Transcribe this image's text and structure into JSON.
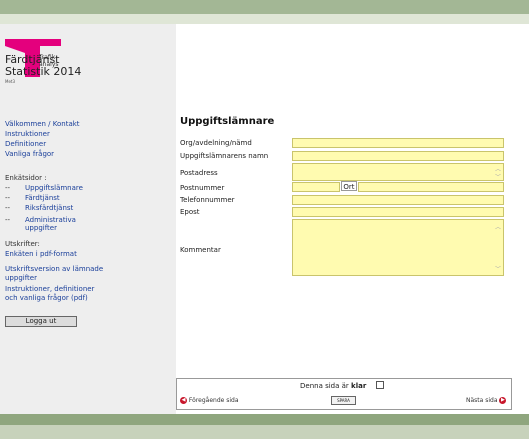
{
  "app": {
    "logo_text_line1": "Trafik",
    "logo_text_line2": "analys",
    "title_line1": "Färdtjänst",
    "title_line2": "Statistik 2014",
    "subtitle": "Met3"
  },
  "sidebar": {
    "links": [
      "Välkommen / Kontakt",
      "Instruktioner",
      "Definitioner",
      "Vanliga frågor"
    ],
    "enkat_heading": "Enkätsidor :",
    "enkat_items": [
      {
        "dash": "--",
        "label": "Uppgiftslämnare"
      },
      {
        "dash": "--",
        "label": "Färdtjänst"
      },
      {
        "dash": "--",
        "label": "Riksfärdtjänst"
      },
      {
        "dash": "--",
        "label_line1": "Administrativa",
        "label_line2": "uppgifter"
      }
    ],
    "utskrifter_heading": "Utskrifter:",
    "print_links": [
      {
        "line1": "Enkäten i pdf-format"
      },
      {
        "line1": "Utskriftsversion av lämnade",
        "line2": "uppgifter"
      },
      {
        "line1": "Instruktioner, definitioner",
        "line2": "och vanliga frågor (pdf)"
      }
    ],
    "logout_label": "Logga ut"
  },
  "form": {
    "heading": "Uppgiftslämnare",
    "fields": {
      "org": {
        "label": "Org/avdelning/nämd",
        "value": ""
      },
      "name": {
        "label": "Uppgiftslämnarens namn",
        "value": ""
      },
      "address": {
        "label": "Postadress",
        "value": ""
      },
      "postnummer": {
        "label": "Postnummer",
        "value": ""
      },
      "ort": {
        "label": "Ort",
        "value": ""
      },
      "phone": {
        "label": "Telefonnummer",
        "value": ""
      },
      "email": {
        "label": "Epost",
        "value": ""
      },
      "comment": {
        "label": "Kommentar",
        "value": ""
      }
    }
  },
  "footer": {
    "done_label_prefix": "Denna sida är",
    "done_label_bold": "klar",
    "prev_label": "Föregående sida",
    "next_label": "Nästa sida",
    "save_label": "SPARA"
  },
  "colors": {
    "top_bar": "#a3b795",
    "sidebar_bg": "#eeeeee",
    "input_bg": "#fffbb0",
    "link": "#1a3f9a",
    "nav_arrow": "#c8172c",
    "logo": "#e4007d"
  }
}
